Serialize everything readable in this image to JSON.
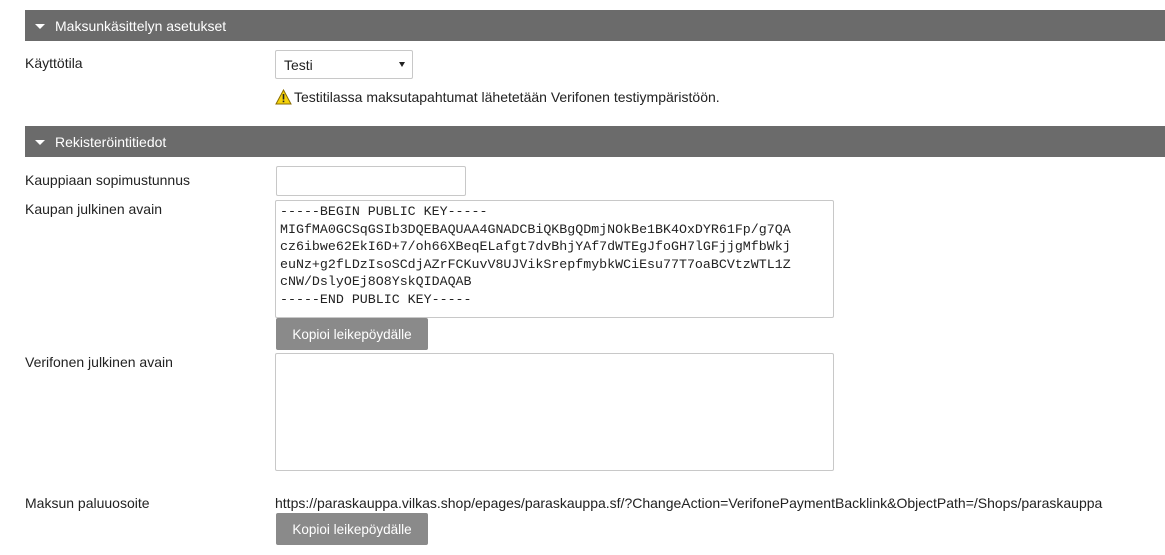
{
  "payment_settings": {
    "header": "Maksunkäsittelyn asetukset",
    "mode_label": "Käyttötila",
    "mode_value": "Testi",
    "warning_text": "Testitilassa maksutapahtumat lähetetään Verifonen testiympäristöön."
  },
  "registration": {
    "header": "Rekisteröintitiedot",
    "merchant_agreement_label": "Kauppiaan sopimustunnus",
    "merchant_agreement_value": "",
    "shop_public_key_label": "Kaupan julkinen avain",
    "shop_public_key_value": "-----BEGIN PUBLIC KEY-----\nMIGfMA0GCSqGSIb3DQEBAQUAA4GNADCBiQKBgQDmjNOkBe1BK4OxDYR61Fp/g7QA\ncz6ibwe62EkI6D+7/oh66XBeqELafgt7dvBhjYAf7dWTEgJfoGH7lGFjjgMfbWkj\neuNz+g2fLDzIsoSCdjAZrFCKuvV8UJVikSrepfmybkWCiEsu77T7oaBCVtzWTL1Z\ncNW/DslyOEj8O8YskQIDAQAB\n-----END PUBLIC KEY-----",
    "copy_button_label": "Kopioi leikepöydälle",
    "verifone_public_key_label": "Verifonen julkinen avain",
    "verifone_public_key_value": "",
    "return_address_label": "Maksun paluuosoite",
    "return_address_value": "https://paraskauppa.vilkas.shop/epages/paraskauppa.sf/?ChangeAction=VerifonePaymentBacklink&ObjectPath=/Shops/paraskauppa",
    "copy_button_label_2": "Kopioi leikepöydälle"
  },
  "icons": {
    "section_toggle": "caret-down-icon",
    "warning": "warning-triangle-icon",
    "select_arrow": "select-arrow-icon"
  },
  "colors": {
    "header_bg": "#6b6b6b",
    "button_bg": "#8a8a8a",
    "warning_fill": "#f5d20a"
  }
}
